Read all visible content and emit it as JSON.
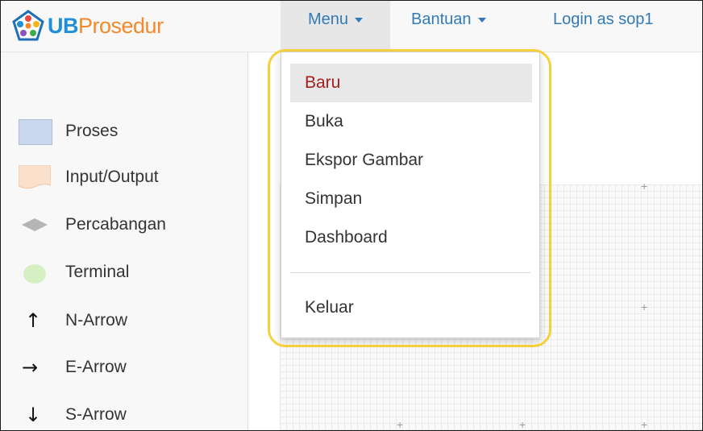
{
  "brand": {
    "ub": "UB",
    "prosedur": "Prosedur",
    "logo_icon": "pentagon-logo-icon"
  },
  "nav": {
    "menu_label": "Menu",
    "bantuan_label": "Bantuan",
    "login_label": "Login as sop1"
  },
  "sidebar": {
    "items": [
      {
        "label": "Proses",
        "icon": "process-shape-icon",
        "color": "#c9d8ee"
      },
      {
        "label": "Input/Output",
        "icon": "io-shape-icon",
        "color": "#fbe1cc"
      },
      {
        "label": "Percabangan",
        "icon": "decision-diamond-icon",
        "color": "#b5b5b5"
      },
      {
        "label": "Terminal",
        "icon": "terminal-ellipse-icon",
        "color": "#d6f0c4"
      },
      {
        "label": "N-Arrow",
        "icon": "arrow-up-icon",
        "glyph": "↑"
      },
      {
        "label": "E-Arrow",
        "icon": "arrow-right-icon",
        "glyph": "→"
      },
      {
        "label": "S-Arrow",
        "icon": "arrow-down-icon",
        "glyph": "↓"
      }
    ]
  },
  "dropdown": {
    "items": [
      {
        "label": "Baru",
        "active": true
      },
      {
        "label": "Buka"
      },
      {
        "label": "Ekspor Gambar"
      },
      {
        "label": "Simpan"
      },
      {
        "label": "Dashboard"
      },
      {
        "label": "Keluar"
      }
    ]
  },
  "colors": {
    "accent": "#337ab7",
    "highlight": "#f6cf3d",
    "active_text": "#a51d1d"
  }
}
